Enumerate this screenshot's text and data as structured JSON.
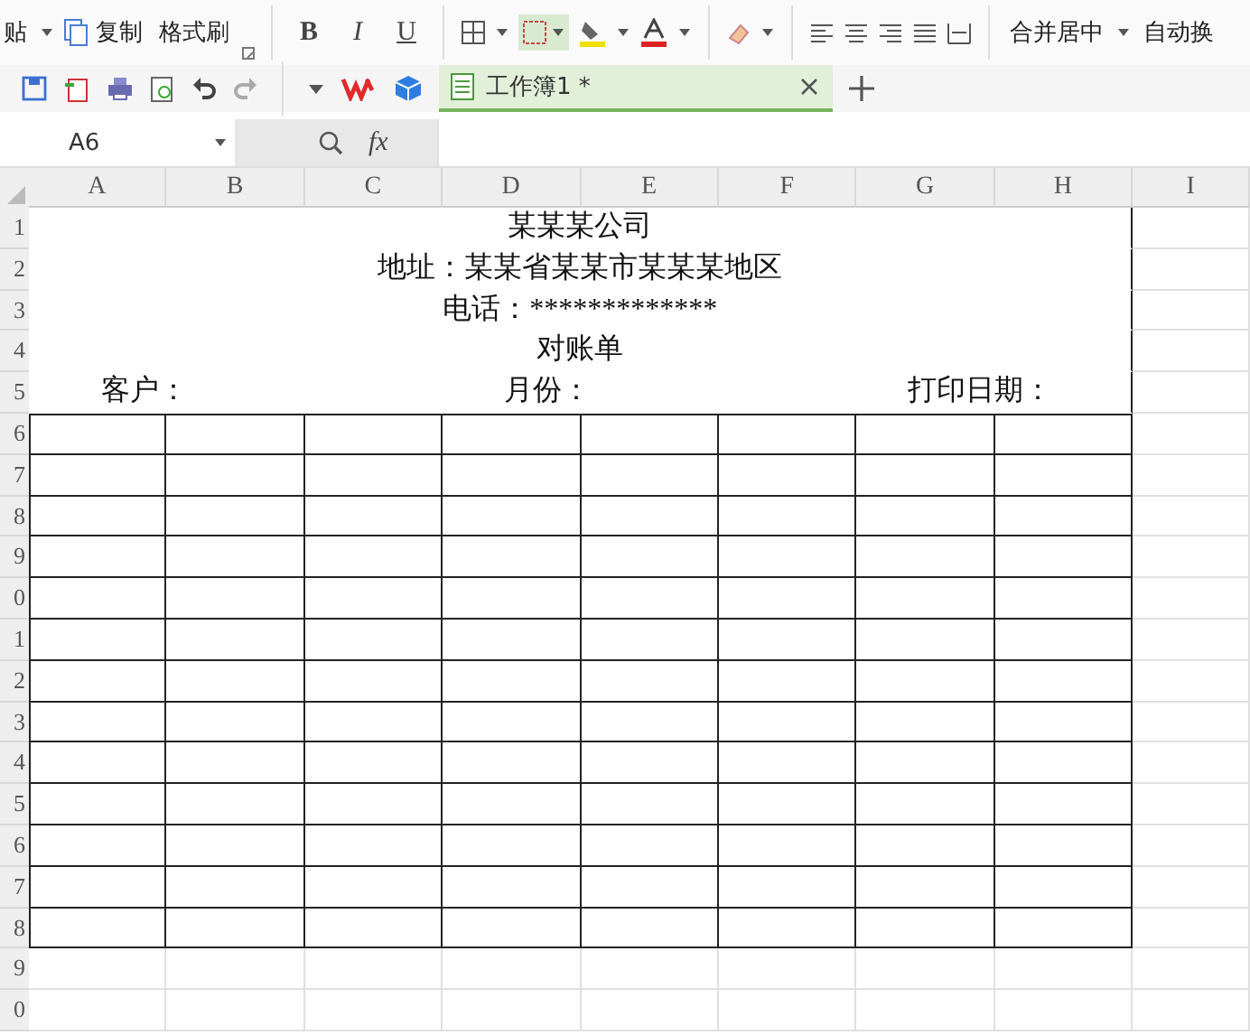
{
  "ribbon": {
    "paste": {
      "label": "贴"
    },
    "copy": {
      "label": "复制"
    },
    "format_painter": {
      "label": "格式刷"
    },
    "font_buttons": [
      {
        "label": "B",
        "kind": "bold"
      },
      {
        "label": "I",
        "kind": "italic"
      },
      {
        "label": "U",
        "kind": "underline"
      }
    ],
    "merge": {
      "label": "合并居中"
    },
    "wrap": {
      "label": "自动换"
    }
  },
  "document_tabs": [
    {
      "label": "工作簿1 *",
      "selected": true
    }
  ],
  "formula_bar": {
    "name_box": "A6",
    "fx": "fx"
  },
  "columns": [
    "A",
    "B",
    "C",
    "D",
    "E",
    "F",
    "G",
    "H",
    "I"
  ],
  "rows": [
    {
      "header": "1",
      "kind": "title",
      "text": "某某某公司"
    },
    {
      "header": "2",
      "kind": "title",
      "text": "地址：某某省某某市某某某地区"
    },
    {
      "header": "3",
      "kind": "title",
      "text": "电话：*************"
    },
    {
      "header": "4",
      "kind": "title",
      "text": "对账单"
    },
    {
      "header": "5",
      "kind": "labels",
      "customer": "客户：",
      "month": "月份：",
      "print_date": "打印日期："
    },
    {
      "header": "6",
      "kind": "bordered"
    },
    {
      "header": "7",
      "kind": "bordered"
    },
    {
      "header": "8",
      "kind": "bordered"
    },
    {
      "header": "9",
      "kind": "bordered"
    },
    {
      "header": "0",
      "kind": "bordered"
    },
    {
      "header": "1",
      "kind": "bordered"
    },
    {
      "header": "2",
      "kind": "bordered"
    },
    {
      "header": "3",
      "kind": "bordered"
    },
    {
      "header": "4",
      "kind": "bordered"
    },
    {
      "header": "5",
      "kind": "bordered"
    },
    {
      "header": "6",
      "kind": "bordered"
    },
    {
      "header": "7",
      "kind": "bordered"
    },
    {
      "header": "8",
      "kind": "bordered"
    },
    {
      "header": "9",
      "kind": "blank"
    },
    {
      "header": "0",
      "kind": "blank"
    }
  ]
}
